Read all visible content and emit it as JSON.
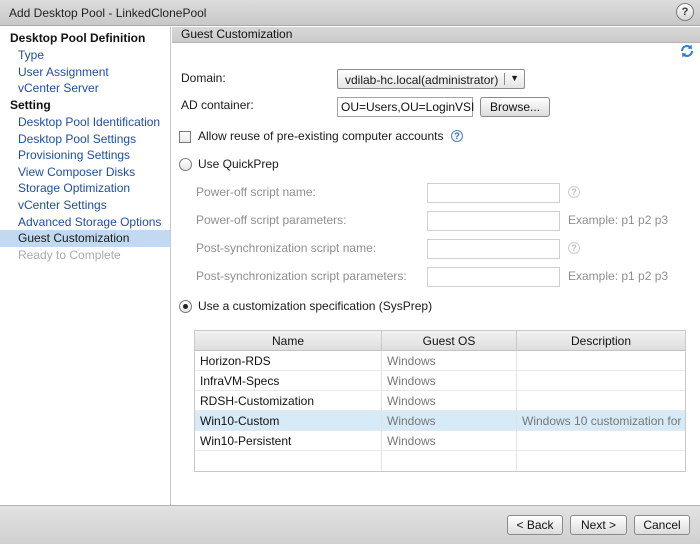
{
  "window": {
    "title": "Add Desktop Pool - LinkedClonePool",
    "help_label": "?"
  },
  "sidebar": {
    "sections": [
      {
        "title": "Desktop Pool Definition",
        "items": [
          {
            "label": "Type",
            "state": "link"
          },
          {
            "label": "User Assignment",
            "state": "link"
          },
          {
            "label": "vCenter Server",
            "state": "link"
          }
        ]
      },
      {
        "title": "Setting",
        "items": [
          {
            "label": "Desktop Pool Identification",
            "state": "link"
          },
          {
            "label": "Desktop Pool Settings",
            "state": "link"
          },
          {
            "label": "Provisioning Settings",
            "state": "link"
          },
          {
            "label": "View Composer Disks",
            "state": "link"
          },
          {
            "label": "Storage Optimization",
            "state": "link"
          },
          {
            "label": "vCenter Settings",
            "state": "link"
          },
          {
            "label": "Advanced Storage Options",
            "state": "link"
          },
          {
            "label": "Guest Customization",
            "state": "active"
          },
          {
            "label": "Ready to Complete",
            "state": "disabled"
          }
        ]
      }
    ]
  },
  "main": {
    "header": "Guest Customization",
    "refresh_icon": "refresh-icon",
    "domain": {
      "label": "Domain:",
      "value": "vdilab-hc.local(administrator)"
    },
    "ad_container": {
      "label": "AD container:",
      "value": "OU=Users,OU=LoginVSI",
      "browse_label": "Browse..."
    },
    "allow_reuse": {
      "label": "Allow reuse of pre-existing computer accounts",
      "checked": false
    },
    "quickprep": {
      "label": "Use QuickPrep",
      "selected": false,
      "fields": [
        {
          "label": "Power-off script name:",
          "value": "",
          "hint": ""
        },
        {
          "label": "Power-off script parameters:",
          "value": "",
          "hint": "Example: p1 p2 p3"
        },
        {
          "label": "Post-synchronization script name:",
          "value": "",
          "hint": ""
        },
        {
          "label": "Post-synchronization script parameters:",
          "value": "",
          "hint": "Example: p1 p2 p3"
        }
      ]
    },
    "sysprep": {
      "label": "Use a customization specification (SysPrep)",
      "selected": true,
      "columns": [
        "Name",
        "Guest OS",
        "Description"
      ],
      "rows": [
        {
          "name": "Horizon-RDS",
          "os": "Windows",
          "description": "",
          "selected": false
        },
        {
          "name": "InfraVM-Specs",
          "os": "Windows",
          "description": "",
          "selected": false
        },
        {
          "name": "RDSH-Customization",
          "os": "Windows",
          "description": "",
          "selected": false
        },
        {
          "name": "Win10-Custom",
          "os": "Windows",
          "description": "Windows 10 customization for",
          "selected": true
        },
        {
          "name": "Win10-Persistent",
          "os": "Windows",
          "description": "",
          "selected": false
        }
      ]
    }
  },
  "footer": {
    "back_label": "< Back",
    "next_label": "Next >",
    "cancel_label": "Cancel"
  },
  "colors": {
    "link": "#1f4e9c",
    "active_item": "#c3d9f1",
    "selected_row": "#d6eaf8"
  }
}
